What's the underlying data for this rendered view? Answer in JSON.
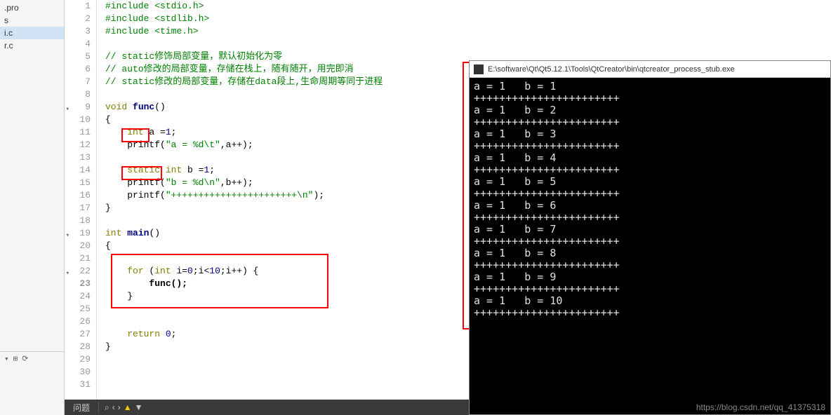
{
  "sidebar": {
    "items": [
      {
        "label": ".pro"
      },
      {
        "label": "s"
      },
      {
        "label": "i.c"
      },
      {
        "label": "r.c"
      }
    ]
  },
  "editor": {
    "lines": [
      {
        "n": 1,
        "html": "<span class='kw-preproc'>#include</span> <span class='kw-string'>&lt;stdio.h&gt;</span>"
      },
      {
        "n": 2,
        "html": "<span class='kw-preproc'>#include</span> <span class='kw-string'>&lt;stdlib.h&gt;</span>"
      },
      {
        "n": 3,
        "html": "<span class='kw-preproc'>#include</span> <span class='kw-string'>&lt;time.h&gt;</span>"
      },
      {
        "n": 4,
        "html": ""
      },
      {
        "n": 5,
        "html": "<span class='kw-comment'>// static修饰局部变量，默认初始化为零</span>"
      },
      {
        "n": 6,
        "html": "<span class='kw-comment'>// auto修改的局部变量，存储在栈上，随有随开，用完即消</span>"
      },
      {
        "n": 7,
        "html": "<span class='kw-comment'>// static修改的局部变量，存储在data段上,生命周期等同于进程</span>"
      },
      {
        "n": 8,
        "html": ""
      },
      {
        "n": 9,
        "fold": true,
        "html": "<span class='kw-type'>void</span> <span class='kw-funcname'>func</span>()"
      },
      {
        "n": 10,
        "html": "{"
      },
      {
        "n": 11,
        "html": "    <span class='kw-type'>int</span> a =<span class='kw-num'>1</span>;"
      },
      {
        "n": 12,
        "html": "    printf(<span class='kw-strlit'>\"a = %d\\t\"</span>,a++);"
      },
      {
        "n": 13,
        "html": ""
      },
      {
        "n": 14,
        "html": "    <span class='kw-keyword'>static</span> <span class='kw-type'>int</span> b =<span class='kw-num'>1</span>;"
      },
      {
        "n": 15,
        "html": "    printf(<span class='kw-strlit'>\"b = %d\\n\"</span>,b++);"
      },
      {
        "n": 16,
        "html": "    printf(<span class='kw-strlit'>\"+++++++++++++++++++++++\\n\"</span>);"
      },
      {
        "n": 17,
        "html": "}"
      },
      {
        "n": 18,
        "html": ""
      },
      {
        "n": 19,
        "fold": true,
        "html": "<span class='kw-type'>int</span> <span class='kw-funcname'>main</span>()"
      },
      {
        "n": 20,
        "html": "{"
      },
      {
        "n": 21,
        "html": ""
      },
      {
        "n": 22,
        "fold": true,
        "html": "    <span class='kw-keyword'>for</span> (<span class='kw-type'>int</span> i=<span class='kw-num'>0</span>;i&lt;<span class='kw-num'>10</span>;i++) {"
      },
      {
        "n": 23,
        "bold": true,
        "html": "        func();"
      },
      {
        "n": 24,
        "html": "    }"
      },
      {
        "n": 25,
        "html": ""
      },
      {
        "n": 26,
        "html": ""
      },
      {
        "n": 27,
        "html": "    <span class='kw-keyword'>return</span> <span class='kw-num'>0</span>;"
      },
      {
        "n": 28,
        "html": "}"
      },
      {
        "n": 29,
        "html": ""
      },
      {
        "n": 30,
        "html": ""
      },
      {
        "n": 31,
        "html": ""
      }
    ]
  },
  "console": {
    "title": "E:\\software\\Qt\\Qt5.12.1\\Tools\\QtCreator\\bin\\qtcreator_process_stub.exe",
    "output": [
      "a = 1   b = 1",
      "+++++++++++++++++++++++",
      "a = 1   b = 2",
      "+++++++++++++++++++++++",
      "a = 1   b = 3",
      "+++++++++++++++++++++++",
      "a = 1   b = 4",
      "+++++++++++++++++++++++",
      "a = 1   b = 5",
      "+++++++++++++++++++++++",
      "a = 1   b = 6",
      "+++++++++++++++++++++++",
      "a = 1   b = 7",
      "+++++++++++++++++++++++",
      "a = 1   b = 8",
      "+++++++++++++++++++++++",
      "a = 1   b = 9",
      "+++++++++++++++++++++++",
      "a = 1   b = 10",
      "+++++++++++++++++++++++"
    ]
  },
  "statusbar": {
    "problems_label": "问题"
  },
  "watermark": "https://blog.csdn.net/qq_41375318"
}
